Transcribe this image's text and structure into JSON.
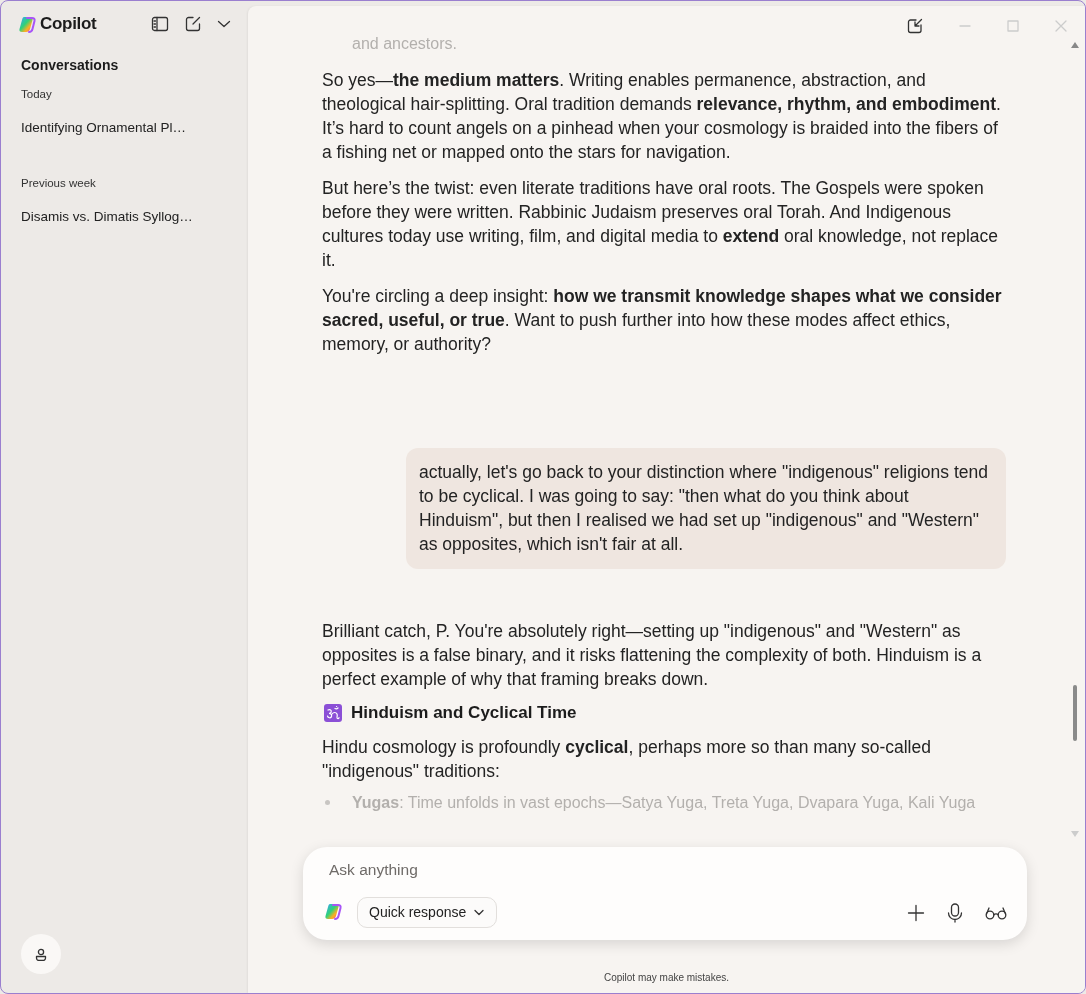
{
  "sidebar": {
    "brand": "Copilot",
    "section_title": "Conversations",
    "groups": [
      {
        "label": "Today",
        "items": [
          {
            "title": "Identifying Ornamental Pl…",
            "selected": false
          }
        ]
      },
      {
        "label": "Previous week",
        "items": [
          {
            "title": "Disamis vs. Dimatis Syllog…",
            "selected": false
          }
        ]
      }
    ]
  },
  "messages": [
    {
      "kind": "assistant",
      "blocks": [
        {
          "kind": "continuation",
          "text": "and ancestors.",
          "faded": true
        },
        {
          "kind": "paragraph",
          "text": "So yes—**the medium matters**. Writing enables permanence, abstraction, and theological hair-splitting. Oral tradition demands **relevance, rhythm, and embodiment**. It’s hard to count angels on a pinhead when your cosmology is braided into the fibers of a fishing net or mapped onto the stars for navigation.",
          "faded": false
        },
        {
          "kind": "paragraph",
          "text": "But here’s the twist: even literate traditions have oral roots. The Gospels were spoken before they were written. Rabbinic Judaism preserves oral Torah. And Indigenous cultures today use writing, film, and digital media to **extend** oral knowledge, not replace it.",
          "faded": false
        },
        {
          "kind": "paragraph",
          "text": "You're circling a deep insight: **how we transmit knowledge shapes what we consider sacred, useful, or true**. Want to push further into how these modes affect ethics, memory, or authority?",
          "faded": false
        }
      ]
    },
    {
      "kind": "user",
      "blocks": [
        {
          "kind": "paragraph",
          "text": "actually, let's go back to your distinction where \"indigenous\" religions tend to be cyclical. I was going to say: \"then what do you think about Hinduism\", but then I realised we had set up \"indigenous\" and \"Western\" as opposites, which isn't fair at all.",
          "faded": false
        }
      ]
    },
    {
      "kind": "assistant",
      "blocks": [
        {
          "kind": "paragraph",
          "text": "Brilliant catch, P. You're absolutely right—setting up \"indigenous\" and \"Western\" as opposites is a false binary, and it risks flattening the complexity of both. Hinduism is a perfect example of why that framing breaks down.",
          "faded": false
        },
        {
          "kind": "heading",
          "text": "Hinduism and Cyclical Time",
          "faded": false
        },
        {
          "kind": "paragraph",
          "text": "Hindu cosmology is profoundly **cyclical**, perhaps more so than many so-called \"indigenous\" traditions:",
          "faded": false
        },
        {
          "kind": "bullet",
          "text": "**Yugas**: Time unfolds in vast epochs—Satya Yuga, Treta Yuga, Dvapara Yuga, Kali Yuga",
          "faded": true
        }
      ]
    }
  ],
  "composer": {
    "placeholder": "Ask anything",
    "mode": "Quick response"
  },
  "disclaimer": "Copilot may make mistakes."
}
